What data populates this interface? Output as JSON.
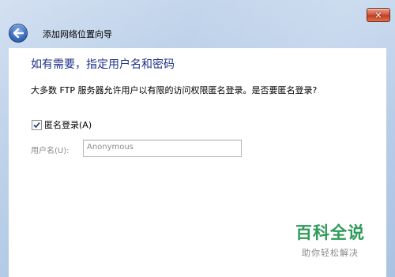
{
  "window": {
    "title": "添加网络位置向导",
    "close_glyph": "✕"
  },
  "content": {
    "heading": "如有需要，指定用户名和密码",
    "description": "大多数 FTP 服务器允许用户以有限的访问权限匿名登录。是否要匿名登录?",
    "anonymous_login": {
      "label": "匿名登录(A)",
      "checked": true
    },
    "username": {
      "label": "用户名(U):",
      "value": "Anonymous"
    }
  },
  "watermark": {
    "main": "百科全说",
    "sub": "助你轻松解决"
  },
  "colors": {
    "heading": "#1e3287",
    "frame": "#b3cae6",
    "watermark_green": "#2f9a5a"
  },
  "icons": [
    "back-arrow-icon",
    "close-icon",
    "checkmark-icon"
  ]
}
